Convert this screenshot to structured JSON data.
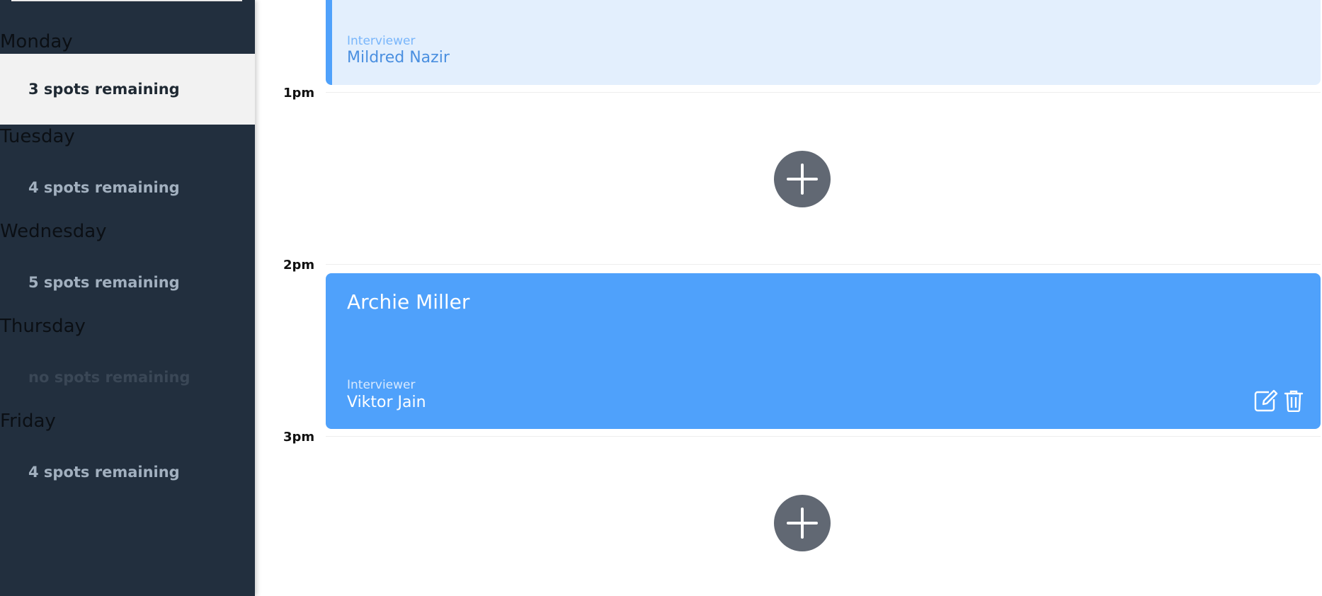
{
  "sidebar": {
    "days": [
      {
        "name": "Monday",
        "spots": "3 spots remaining",
        "selected": true
      },
      {
        "name": "Tuesday",
        "spots": "4 spots remaining"
      },
      {
        "name": "Wednesday",
        "spots": "5 spots remaining"
      },
      {
        "name": "Thursday",
        "spots": "no spots remaining"
      },
      {
        "name": "Friday",
        "spots": "4 spots remaining"
      }
    ]
  },
  "schedule": {
    "times": [
      "1pm",
      "2pm",
      "3pm"
    ],
    "appointments": [
      {
        "interviewer_label": "Interviewer",
        "interviewer": "Mildred Nazir"
      },
      {
        "student": "Archie Miller",
        "interviewer_label": "Interviewer",
        "interviewer": "Viktor Jain"
      }
    ],
    "add_icon": "plus-icon",
    "action_icons": [
      "edit-icon",
      "trash-icon"
    ]
  },
  "colors": {
    "sidebar_bg": "#222f3e",
    "selected_bg": "#f2f2f2",
    "appointment_accent": "#4fa1fb",
    "appointment_light_bg": "#e3effd",
    "add_button": "#616873"
  }
}
